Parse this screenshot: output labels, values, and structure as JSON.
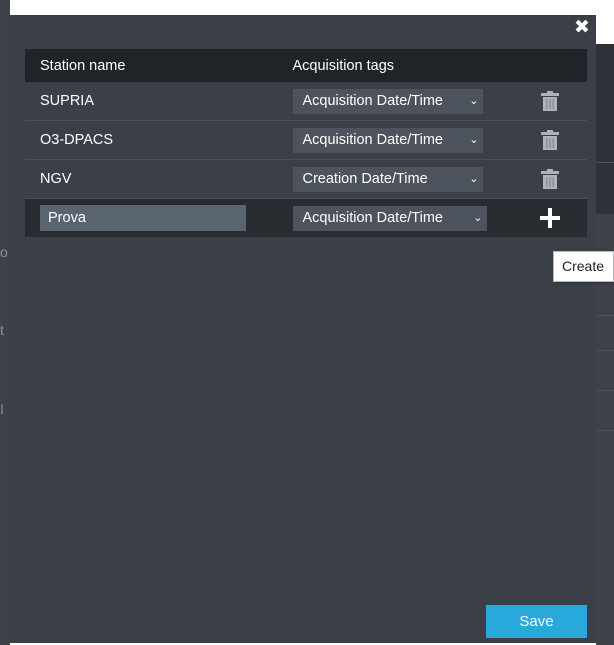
{
  "dialog": {
    "close_icon": "✖",
    "columns": {
      "station_name": "Station name",
      "acquisition_tags": "Acquisition tags"
    },
    "rows": [
      {
        "name": "SUPRIA",
        "tag": "Acquisition Date/Time",
        "action_icon": "trash-icon"
      },
      {
        "name": "O3-DPACS",
        "tag": "Acquisition Date/Time",
        "action_icon": "trash-icon"
      },
      {
        "name": "NGV",
        "tag": "Creation Date/Time",
        "action_icon": "trash-icon"
      }
    ],
    "new_row": {
      "name_value": "Prova",
      "tag": "Acquisition Date/Time",
      "action_icon": "plus-icon"
    },
    "tooltip": "Create",
    "save_label": "Save"
  },
  "colors": {
    "dialog_bg": "#3b4048",
    "header_bg": "#202328",
    "save_accent": "#29a8dc",
    "select_bg": "#4c535c"
  }
}
